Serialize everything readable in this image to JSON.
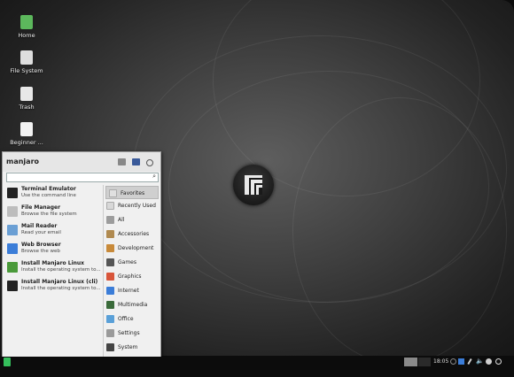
{
  "desktop_icons": [
    {
      "label": "Home",
      "icon": "home-folder-icon",
      "color": "#5cb85c"
    },
    {
      "label": "File System",
      "icon": "drive-icon",
      "color": "#dddddd"
    },
    {
      "label": "Trash",
      "icon": "trash-icon",
      "color": "#e8e8e8"
    },
    {
      "label": "Beginner ...",
      "icon": "document-icon",
      "color": "#f2f2f2"
    }
  ],
  "menu": {
    "user": "manjaro",
    "search_value": "",
    "apps": [
      {
        "title": "Terminal Emulator",
        "desc": "Use the command line",
        "icon": "terminal-icon",
        "color": "#222222"
      },
      {
        "title": "File Manager",
        "desc": "Browse the file system",
        "icon": "file-manager-icon",
        "color": "#bdbdbd"
      },
      {
        "title": "Mail Reader",
        "desc": "Read your email",
        "icon": "mail-icon",
        "color": "#6a9fd4"
      },
      {
        "title": "Web Browser",
        "desc": "Browse the web",
        "icon": "web-browser-icon",
        "color": "#3b7dd8"
      },
      {
        "title": "Install Manjaro Linux",
        "desc": "Install the operating system to...",
        "icon": "installer-icon",
        "color": "#4a9a3a"
      },
      {
        "title": "Install Manjaro Linux (cli)",
        "desc": "Install the operating system to...",
        "icon": "terminal-icon",
        "color": "#222222"
      }
    ],
    "categories": [
      {
        "label": "Favorites",
        "icon": "favorites-icon",
        "color": "#e0e0e0",
        "selected": true
      },
      {
        "label": "Recently Used",
        "icon": "recent-icon",
        "color": "#d8d8d8",
        "selected": false
      },
      {
        "label": "All",
        "icon": "all-apps-icon",
        "color": "#9c9c9c",
        "selected": false
      },
      {
        "label": "Accessories",
        "icon": "accessories-icon",
        "color": "#b08a50",
        "selected": false
      },
      {
        "label": "Development",
        "icon": "development-icon",
        "color": "#c88a3a",
        "selected": false
      },
      {
        "label": "Games",
        "icon": "games-icon",
        "color": "#555555",
        "selected": false
      },
      {
        "label": "Graphics",
        "icon": "graphics-icon",
        "color": "#d8553a",
        "selected": false
      },
      {
        "label": "Internet",
        "icon": "internet-icon",
        "color": "#3b7dd8",
        "selected": false
      },
      {
        "label": "Multimedia",
        "icon": "multimedia-icon",
        "color": "#3a6a3a",
        "selected": false
      },
      {
        "label": "Office",
        "icon": "office-icon",
        "color": "#5aa0d8",
        "selected": false
      },
      {
        "label": "Settings",
        "icon": "settings-icon",
        "color": "#9a9a9a",
        "selected": false
      },
      {
        "label": "System",
        "icon": "system-icon",
        "color": "#444444",
        "selected": false
      }
    ]
  },
  "panel": {
    "clock": "18:05",
    "start_color": "#35bf5c"
  }
}
